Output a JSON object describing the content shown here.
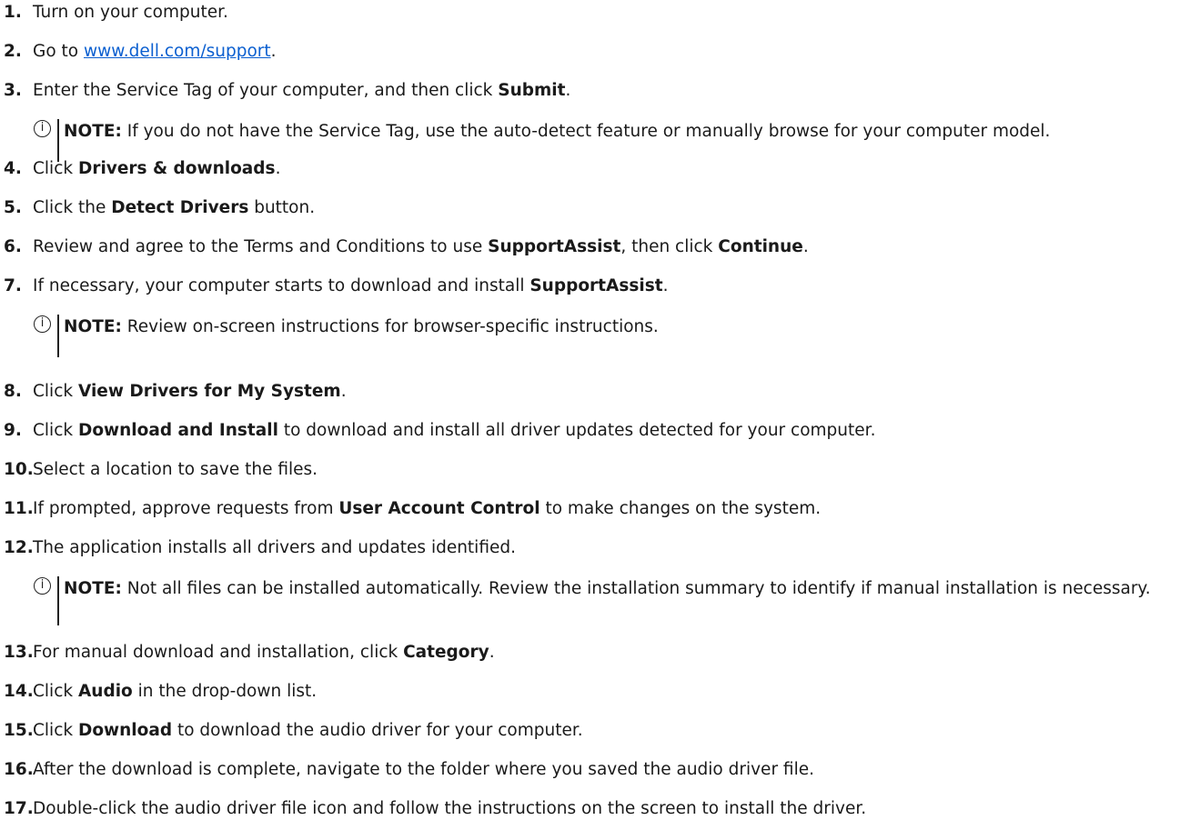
{
  "steps": [
    {
      "n": "1.",
      "parts": [
        {
          "t": "Turn on your computer."
        }
      ]
    },
    {
      "n": "2.",
      "parts": [
        {
          "t": "Go to "
        },
        {
          "t": "www.dell.com/support",
          "link": true
        },
        {
          "t": "."
        }
      ]
    },
    {
      "n": "3.",
      "parts": [
        {
          "t": "Enter the Service Tag of your computer, and then click "
        },
        {
          "t": "Submit",
          "b": true
        },
        {
          "t": "."
        }
      ]
    },
    {
      "n": "4.",
      "parts": [
        {
          "t": "Click "
        },
        {
          "t": "Drivers & downloads",
          "b": true
        },
        {
          "t": "."
        }
      ]
    },
    {
      "n": "5.",
      "parts": [
        {
          "t": "Click the "
        },
        {
          "t": "Detect Drivers",
          "b": true
        },
        {
          "t": " button."
        }
      ]
    },
    {
      "n": "6.",
      "parts": [
        {
          "t": "Review and agree to the Terms and Conditions to use "
        },
        {
          "t": "SupportAssist",
          "b": true
        },
        {
          "t": ", then click "
        },
        {
          "t": "Continue",
          "b": true
        },
        {
          "t": "."
        }
      ]
    },
    {
      "n": "7.",
      "parts": [
        {
          "t": "If necessary, your computer starts to download and install "
        },
        {
          "t": "SupportAssist",
          "b": true
        },
        {
          "t": "."
        }
      ]
    },
    {
      "n": "8.",
      "parts": [
        {
          "t": "Click "
        },
        {
          "t": "View Drivers for My System",
          "b": true
        },
        {
          "t": "."
        }
      ]
    },
    {
      "n": "9.",
      "parts": [
        {
          "t": "Click "
        },
        {
          "t": "Download and Install",
          "b": true
        },
        {
          "t": " to download and install all driver updates detected for your computer."
        }
      ]
    },
    {
      "n": "10.",
      "parts": [
        {
          "t": "Select a location to save the files."
        }
      ]
    },
    {
      "n": "11.",
      "parts": [
        {
          "t": "If prompted, approve requests from "
        },
        {
          "t": "User Account Control",
          "b": true
        },
        {
          "t": " to make changes on the system."
        }
      ]
    },
    {
      "n": "12.",
      "parts": [
        {
          "t": "The application installs all drivers and updates identified."
        }
      ]
    },
    {
      "n": "13.",
      "parts": [
        {
          "t": "For manual download and installation, click "
        },
        {
          "t": "Category",
          "b": true
        },
        {
          "t": "."
        }
      ]
    },
    {
      "n": "14.",
      "parts": [
        {
          "t": "Click "
        },
        {
          "t": "Audio",
          "b": true
        },
        {
          "t": " in the drop-down list."
        }
      ]
    },
    {
      "n": "15.",
      "parts": [
        {
          "t": "Click "
        },
        {
          "t": "Download",
          "b": true
        },
        {
          "t": " to download the audio driver for your computer."
        }
      ]
    },
    {
      "n": "16.",
      "parts": [
        {
          "t": "After the download is complete, navigate to the folder where you saved the audio driver file."
        }
      ]
    },
    {
      "n": "17.",
      "parts": [
        {
          "t": "Double-click the audio driver file icon and follow the instructions on the screen to install the driver."
        }
      ]
    }
  ],
  "notes": [
    {
      "label": "NOTE:",
      "text": " If you do not have the Service Tag, use the auto-detect feature or manually browse for your computer model."
    },
    {
      "label": "NOTE:",
      "text": " Review on-screen instructions for browser-specific instructions."
    },
    {
      "label": "NOTE:",
      "text": " Not all files can be installed automatically. Review the installation summary to identify if manual installation is necessary."
    }
  ],
  "icons": {
    "note": "info-icon",
    "note_glyph": "i"
  }
}
